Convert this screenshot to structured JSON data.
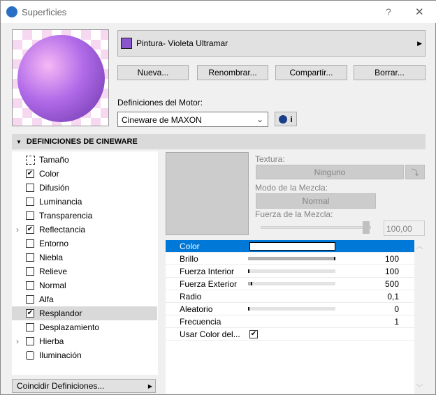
{
  "window": {
    "title": "Superficies",
    "help": "?",
    "close": "✕"
  },
  "material": {
    "name": "Pintura- Violeta Ultramar",
    "swatch": "#8a55cc"
  },
  "buttons": {
    "new": "Nueva...",
    "rename": "Renombrar...",
    "share": "Compartir...",
    "delete": "Borrar..."
  },
  "engine": {
    "label": "Definiciones del Motor:",
    "value": "Cineware de MAXON",
    "info": "i"
  },
  "section": {
    "title": "DEFINICIONES DE CINEWARE"
  },
  "channels": [
    {
      "label": "Tamaño",
      "type": "size"
    },
    {
      "label": "Color",
      "checked": true
    },
    {
      "label": "Difusión",
      "checked": false
    },
    {
      "label": "Luminancia",
      "checked": false
    },
    {
      "label": "Transparencia",
      "checked": false
    },
    {
      "label": "Reflectancia",
      "checked": true,
      "expand": true
    },
    {
      "label": "Entorno",
      "checked": false
    },
    {
      "label": "Niebla",
      "checked": false
    },
    {
      "label": "Relieve",
      "checked": false
    },
    {
      "label": "Normal",
      "checked": false
    },
    {
      "label": "Alfa",
      "checked": false
    },
    {
      "label": "Resplandor",
      "checked": true,
      "selected": true
    },
    {
      "label": "Desplazamiento",
      "checked": false
    },
    {
      "label": "Hierba",
      "checked": false,
      "expand": true
    },
    {
      "label": "Iluminación",
      "type": "light"
    }
  ],
  "match_button": "Coincidir Definiciones...",
  "texture": {
    "label": "Textura:",
    "value": "Ninguno",
    "blend_mode_label": "Modo de la Mezcla:",
    "blend_mode": "Normal",
    "blend_strength_label": "Fuerza de la Mezcla:",
    "blend_strength": "100,00",
    "blend_fraction": 1.0
  },
  "params": [
    {
      "name": "Color",
      "type": "color",
      "selected": true
    },
    {
      "name": "Brillo",
      "value": "100",
      "fraction": 1.0
    },
    {
      "name": "Fuerza Interior",
      "value": "100",
      "fraction": 0.0
    },
    {
      "name": "Fuerza Exterior",
      "value": "500",
      "fraction": 0.05
    },
    {
      "name": "Radio",
      "value": "0,1"
    },
    {
      "name": "Aleatorio",
      "value": "0",
      "fraction": 0.0
    },
    {
      "name": "Frecuencia",
      "value": "1"
    },
    {
      "name": "Usar Color del...",
      "type": "check",
      "checked": true
    }
  ]
}
